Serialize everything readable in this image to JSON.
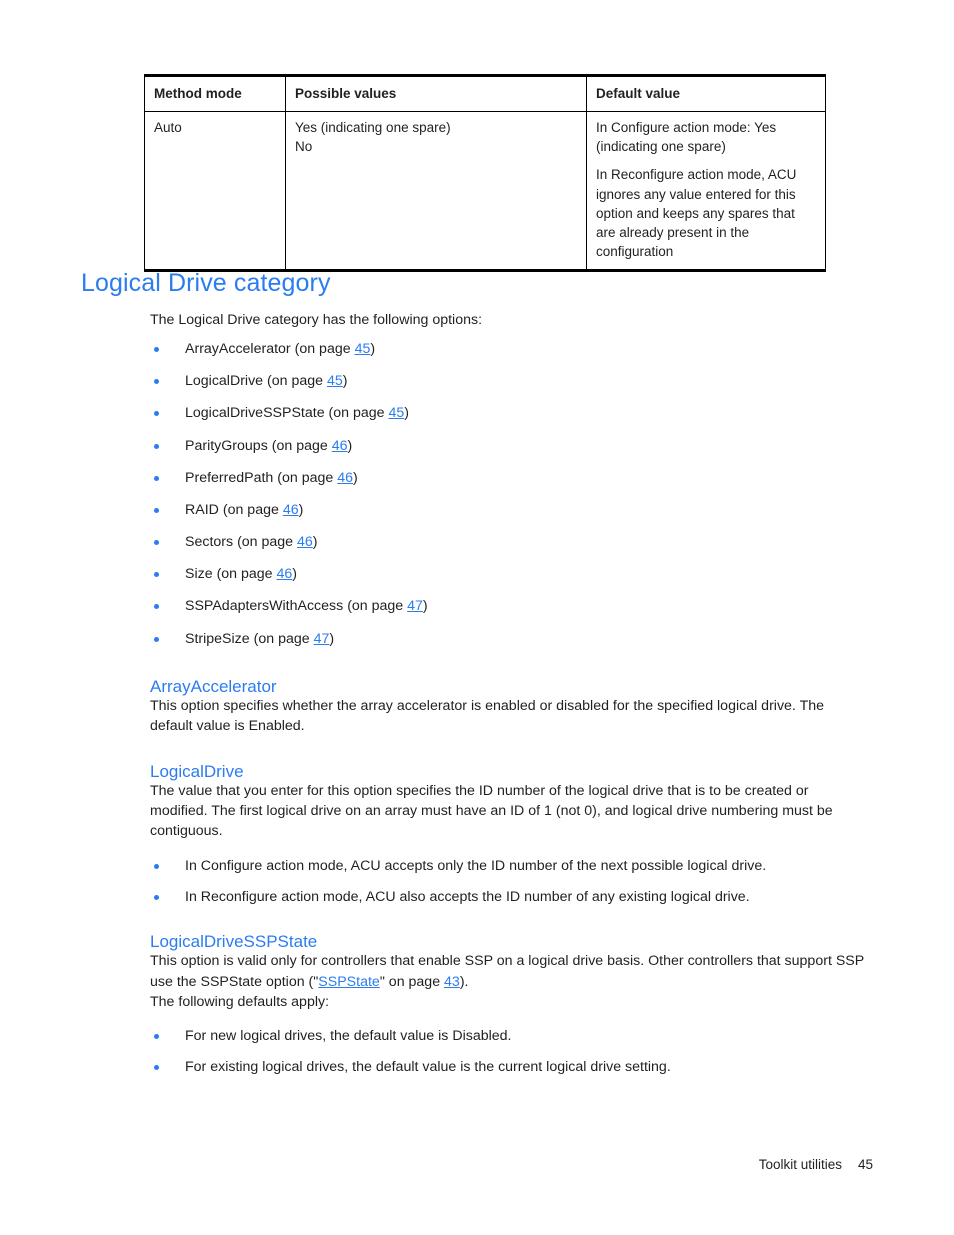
{
  "table": {
    "headers": [
      "Method mode",
      "Possible values",
      "Default value"
    ],
    "rows": [
      {
        "method_mode": "Auto",
        "possible_values": [
          "Yes (indicating one spare)",
          "No"
        ],
        "default_value": [
          "In Configure action mode: Yes (indicating one spare)",
          "In Reconfigure action mode, ACU ignores any value entered for this option and keeps any spares that are already present in the configuration"
        ]
      }
    ]
  },
  "section": {
    "title": "Logical Drive category",
    "intro": "The Logical Drive category has the following options:",
    "options": [
      {
        "name": "ArrayAccelerator",
        "on_page_prefix": "(on page ",
        "page": "45",
        "suffix": ")"
      },
      {
        "name": "LogicalDrive",
        "on_page_prefix": "(on page ",
        "page": "45",
        "suffix": ")"
      },
      {
        "name": "LogicalDriveSSPState",
        "on_page_prefix": "(on page ",
        "page": "45",
        "suffix": ")"
      },
      {
        "name": "ParityGroups",
        "on_page_prefix": "(on page ",
        "page": "46",
        "suffix": ")"
      },
      {
        "name": "PreferredPath",
        "on_page_prefix": "(on page ",
        "page": "46",
        "suffix": ")"
      },
      {
        "name": "RAID",
        "on_page_prefix": "(on page ",
        "page": "46",
        "suffix": ")"
      },
      {
        "name": "Sectors",
        "on_page_prefix": "(on page ",
        "page": "46",
        "suffix": ")"
      },
      {
        "name": "Size",
        "on_page_prefix": "(on page ",
        "page": "46",
        "suffix": ")"
      },
      {
        "name": "SSPAdaptersWithAccess",
        "on_page_prefix": "(on page ",
        "page": "47",
        "suffix": ")"
      },
      {
        "name": "StripeSize",
        "on_page_prefix": "(on page ",
        "page": "47",
        "suffix": ")"
      }
    ]
  },
  "array_accelerator": {
    "heading": "ArrayAccelerator",
    "body": "This option specifies whether the array accelerator is enabled or disabled for the specified logical drive. The default value is Enabled."
  },
  "logical_drive": {
    "heading": "LogicalDrive",
    "body": "The value that you enter for this option specifies the ID number of the logical drive that is to be created or modified. The first logical drive on an array must have an ID of 1 (not 0), and logical drive numbering must be contiguous.",
    "bullets": [
      "In Configure action mode, ACU accepts only the ID number of the next possible logical drive.",
      "In Reconfigure action mode, ACU also accepts the ID number of any existing logical drive."
    ]
  },
  "logical_drive_ssp_state": {
    "heading": "LogicalDriveSSPState",
    "body_part1": "This option is valid only for controllers that enable SSP on a logical drive basis. Other controllers that support SSP use the SSPState option (\"",
    "link_text": "SSPState",
    "body_part2": "\" on page ",
    "link_page": "43",
    "body_part3": ").",
    "defaults_intro": "The following defaults apply:",
    "bullets": [
      "For new logical drives, the default value is Disabled.",
      "For existing logical drives, the default value is the current logical drive setting."
    ]
  },
  "footer": {
    "label": "Toolkit utilities",
    "page_number": "45"
  },
  "colors": {
    "heading_blue": "#2b7cf0",
    "link_blue": "#2b7cf0",
    "text_black": "#231f20",
    "rule_black": "#000000"
  }
}
